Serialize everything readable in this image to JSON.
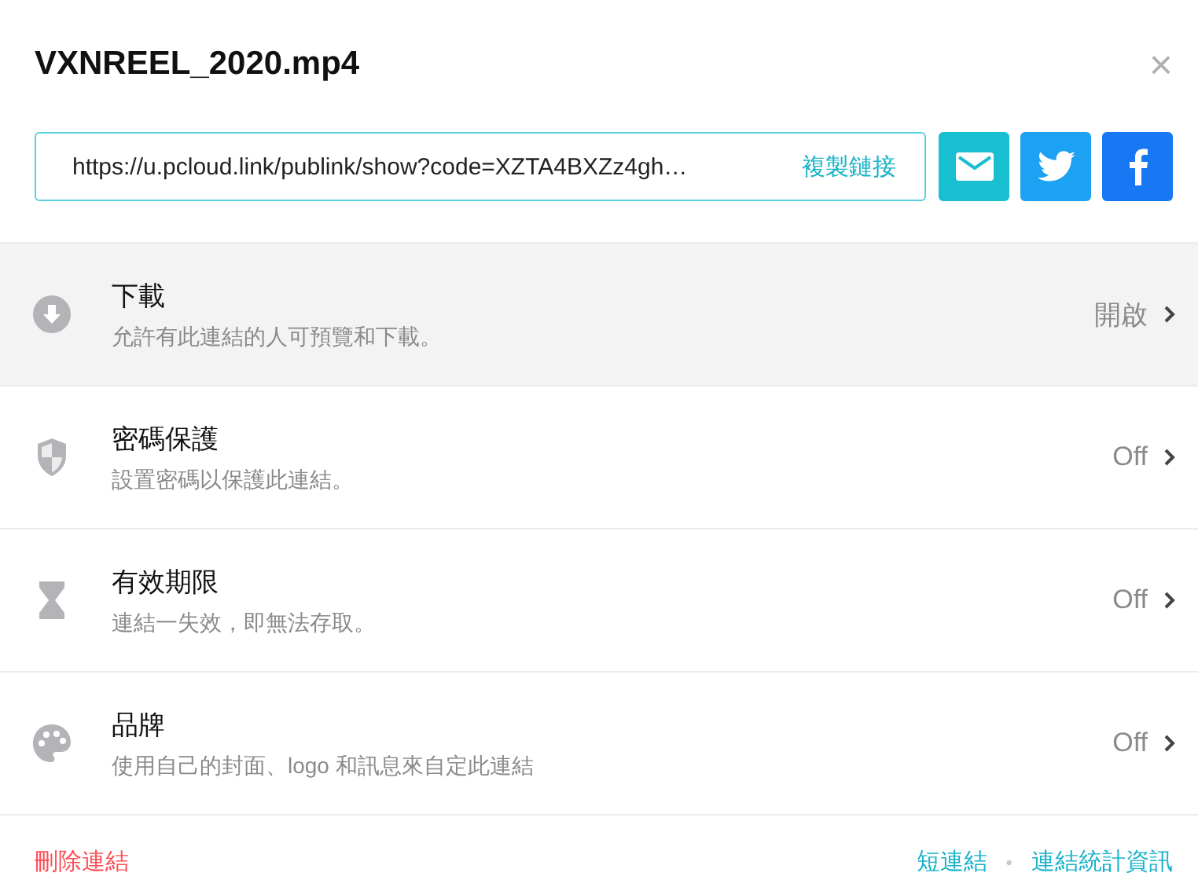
{
  "dialog": {
    "title": "VXNREEL_2020.mp4",
    "close": "×"
  },
  "link": {
    "value": "https://u.pcloud.link/publink/show?code=XZTA4BXZz4gh…",
    "copy": "複製鏈接"
  },
  "share_buttons": [
    {
      "kind": "mail"
    },
    {
      "kind": "twitter"
    },
    {
      "kind": "facebook"
    }
  ],
  "settings": [
    {
      "kind": "download",
      "title": "下載",
      "description": "允許有此連結的人可預覽和下載。",
      "value": "開啟",
      "selected": true
    },
    {
      "kind": "shield",
      "title": "密碼保護",
      "description": "設置密碼以保護此連結。",
      "value": "Off",
      "selected": false
    },
    {
      "kind": "hourglass",
      "title": "有效期限",
      "description": "連結一失效，即無法存取。",
      "value": "Off",
      "selected": false
    },
    {
      "kind": "palette",
      "title": "品牌",
      "description": "使用自己的封面、logo 和訊息來自定此連結",
      "value": "Off",
      "selected": false
    }
  ],
  "footer": {
    "delete": "刪除連結",
    "links": [
      "短連結",
      "連結統計資訊"
    ],
    "separator": "•"
  }
}
